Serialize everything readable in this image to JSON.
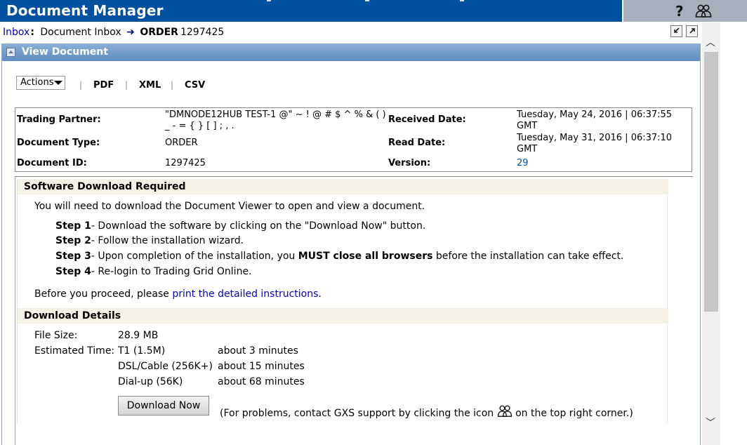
{
  "app": {
    "title": "Document Manager",
    "help_label": "?"
  },
  "breadcrumb": {
    "root_link": "Inbox",
    "separator": ":",
    "folder": "Document Inbox",
    "doc_type": "ORDER",
    "doc_id": "1297425"
  },
  "panel": {
    "title": "View Document"
  },
  "toolbar": {
    "actions_label": "Actions",
    "pdf_label": "PDF",
    "xml_label": "XML",
    "csv_label": "CSV",
    "pipe": "|"
  },
  "doc_info": {
    "trading_partner_label": "Trading Partner:",
    "trading_partner_value_line1": "\"DMNODE12HUB TEST-1 @\" ~ ! @ # $ ^ % & ( )",
    "trading_partner_value_line2": "_ - = { } [ ] ; , .",
    "received_date_label": "Received Date:",
    "received_date_value_line1": "Tuesday, May 24, 2016 | 06:37:55",
    "received_date_value_line2": "GMT",
    "document_type_label": "Document Type:",
    "document_type_value": "ORDER",
    "read_date_label": "Read Date:",
    "read_date_value_line1": "Tuesday, May 31, 2016 | 06:37:10",
    "read_date_value_line2": "GMT",
    "document_id_label": "Document ID:",
    "document_id_value": "1297425",
    "version_label": "Version:",
    "version_value": "29"
  },
  "software_download": {
    "heading": "Software Download Required",
    "intro": "You will need to download the Document Viewer to open and view a document.",
    "steps": [
      {
        "label": "Step 1",
        "text": "- Download the software by clicking on the \"Download Now\" button."
      },
      {
        "label": "Step 2",
        "text": "- Follow the installation wizard."
      },
      {
        "label": "Step 3",
        "text_before": "- Upon completion of the installation, you ",
        "text_bold": "MUST close all browsers",
        "text_after": " before the installation can take effect."
      },
      {
        "label": "Step 4",
        "text": "- Re-login to Trading Grid Online."
      }
    ],
    "proceed_prefix": "Before you proceed, please ",
    "proceed_link": "print the detailed instructions",
    "proceed_suffix": "."
  },
  "download_details": {
    "heading": "Download Details",
    "file_size_label": "File Size:",
    "file_size_value": "28.9 MB",
    "estimated_time_label": "Estimated Time:",
    "rows": [
      {
        "connection": "T1 (1.5M)",
        "time": "about 3 minutes"
      },
      {
        "connection": "DSL/Cable (256K+)",
        "time": "about 15 minutes"
      },
      {
        "connection": "Dial-up (56K)",
        "time": "about 68 minutes"
      }
    ],
    "button_label": "Download Now",
    "support_note_before": "(For problems, contact GXS support by clicking the icon",
    "support_note_after": "on the top right corner.)"
  },
  "colors": {
    "header_bg": "#0050a0",
    "panel_head": "#6f98c9",
    "section_head_bg": "#f5f1e4",
    "link": "#0000cc"
  }
}
